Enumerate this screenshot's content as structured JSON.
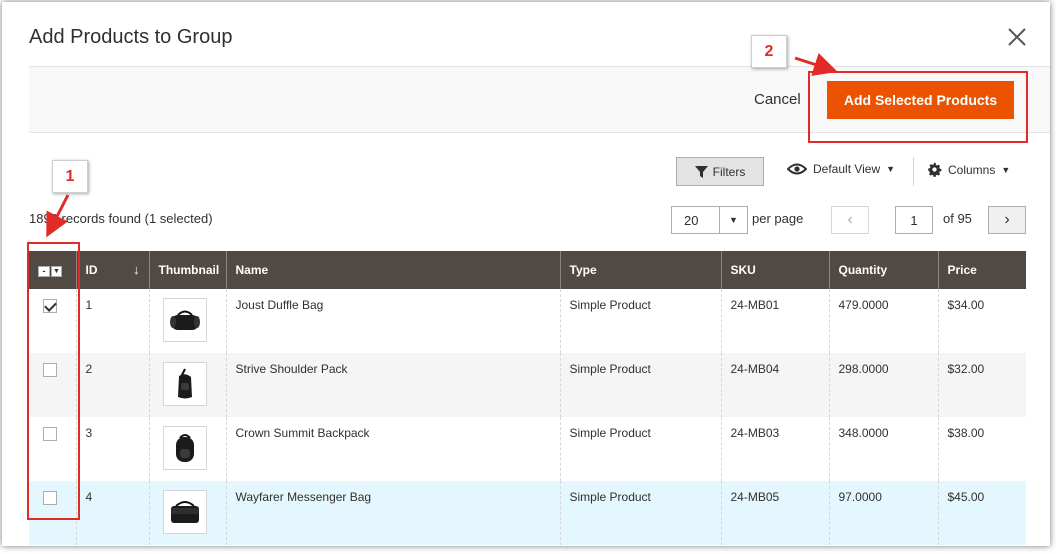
{
  "modal": {
    "title": "Add Products to Group",
    "close_icon": "close-icon"
  },
  "actions": {
    "cancel_label": "Cancel",
    "add_label": "Add Selected Products"
  },
  "callouts": [
    "1",
    "2"
  ],
  "toolbar": {
    "filters_label": "Filters",
    "view_label": "Default View",
    "columns_label": "Columns",
    "records_text": "1899 records found (1 selected)",
    "per_page_value": "20",
    "per_page_label": "per page",
    "current_page": "1",
    "of_pages": "of 95"
  },
  "grid": {
    "columns": [
      "ID",
      "Thumbnail",
      "Name",
      "Type",
      "SKU",
      "Quantity",
      "Price"
    ],
    "sort_indicator": "↓",
    "rows": [
      {
        "checked": true,
        "id": "1",
        "name": "Joust Duffle Bag",
        "type": "Simple Product",
        "sku": "24-MB01",
        "qty": "479.0000",
        "price": "$34.00",
        "thumb": "duffle-bag"
      },
      {
        "checked": false,
        "id": "2",
        "name": "Strive Shoulder Pack",
        "type": "Simple Product",
        "sku": "24-MB04",
        "qty": "298.0000",
        "price": "$32.00",
        "thumb": "shoulder-pack"
      },
      {
        "checked": false,
        "id": "3",
        "name": "Crown Summit Backpack",
        "type": "Simple Product",
        "sku": "24-MB03",
        "qty": "348.0000",
        "price": "$38.00",
        "thumb": "backpack"
      },
      {
        "checked": false,
        "id": "4",
        "name": "Wayfarer Messenger Bag",
        "type": "Simple Product",
        "sku": "24-MB05",
        "qty": "97.0000",
        "price": "$45.00",
        "thumb": "messenger-bag"
      }
    ]
  },
  "colors": {
    "accent": "#eb5202",
    "header_bg": "#514943",
    "annotation": "#e02b27",
    "highlight_row": "#e5f7fe"
  }
}
